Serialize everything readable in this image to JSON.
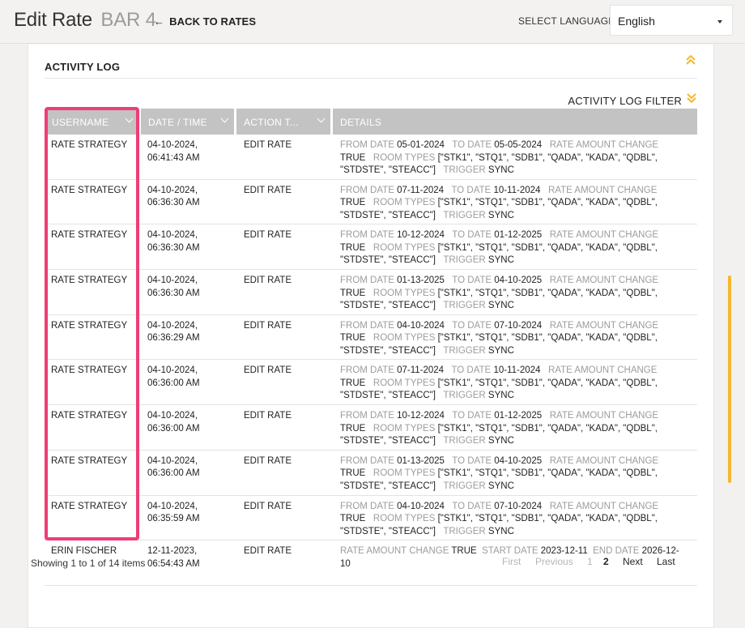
{
  "header": {
    "title": "Edit Rate",
    "subtitle": "BAR 4",
    "back_label": "BACK TO RATES",
    "language_label": "SELECT LANGUAGE",
    "language_value": "English"
  },
  "activity": {
    "title": "ACTIVITY LOG",
    "filter_label": "ACTIVITY LOG FILTER",
    "accent_color": "#f5b730"
  },
  "table": {
    "columns": [
      "USERNAME",
      "DATE / TIME",
      "ACTION T...",
      "DETAILS"
    ],
    "rows": [
      {
        "user": "RATE STRATEGY",
        "date": "04-10-2024,",
        "time": "06:41:43 AM",
        "action": "EDIT RATE",
        "from": "05-01-2024",
        "to": "05-05-2024",
        "rac": "TRUE",
        "rooms": "[\"STK1\", \"STQ1\", \"SDB1\", \"QADA\", \"KADA\", \"QDBL\",",
        "rooms2": "\"STDSTE\", \"STEACC\"]",
        "trigger": "SYNC"
      },
      {
        "user": "RATE STRATEGY",
        "date": "04-10-2024,",
        "time": "06:36:30 AM",
        "action": "EDIT RATE",
        "from": "07-11-2024",
        "to": "10-11-2024",
        "rac": "TRUE",
        "rooms": "[\"STK1\", \"STQ1\", \"SDB1\", \"QADA\", \"KADA\", \"QDBL\",",
        "rooms2": "\"STDSTE\", \"STEACC\"]",
        "trigger": "SYNC"
      },
      {
        "user": "RATE STRATEGY",
        "date": "04-10-2024,",
        "time": "06:36:30 AM",
        "action": "EDIT RATE",
        "from": "10-12-2024",
        "to": "01-12-2025",
        "rac": "TRUE",
        "rooms": "[\"STK1\", \"STQ1\", \"SDB1\", \"QADA\", \"KADA\", \"QDBL\",",
        "rooms2": "\"STDSTE\", \"STEACC\"]",
        "trigger": "SYNC"
      },
      {
        "user": "RATE STRATEGY",
        "date": "04-10-2024,",
        "time": "06:36:30 AM",
        "action": "EDIT RATE",
        "from": "01-13-2025",
        "to": "04-10-2025",
        "rac": "TRUE",
        "rooms": "[\"STK1\", \"STQ1\", \"SDB1\", \"QADA\", \"KADA\", \"QDBL\",",
        "rooms2": "\"STDSTE\", \"STEACC\"]",
        "trigger": "SYNC"
      },
      {
        "user": "RATE STRATEGY",
        "date": "04-10-2024,",
        "time": "06:36:29 AM",
        "action": "EDIT RATE",
        "from": "04-10-2024",
        "to": "07-10-2024",
        "rac": "TRUE",
        "rooms": "[\"STK1\", \"STQ1\", \"SDB1\", \"QADA\", \"KADA\", \"QDBL\",",
        "rooms2": "\"STDSTE\", \"STEACC\"]",
        "trigger": "SYNC"
      },
      {
        "user": "RATE STRATEGY",
        "date": "04-10-2024,",
        "time": "06:36:00 AM",
        "action": "EDIT RATE",
        "from": "07-11-2024",
        "to": "10-11-2024",
        "rac": "TRUE",
        "rooms": "[\"STK1\", \"STQ1\", \"SDB1\", \"QADA\", \"KADA\", \"QDBL\",",
        "rooms2": "\"STDSTE\", \"STEACC\"]",
        "trigger": "SYNC"
      },
      {
        "user": "RATE STRATEGY",
        "date": "04-10-2024,",
        "time": "06:36:00 AM",
        "action": "EDIT RATE",
        "from": "10-12-2024",
        "to": "01-12-2025",
        "rac": "TRUE",
        "rooms": "[\"STK1\", \"STQ1\", \"SDB1\", \"QADA\", \"KADA\", \"QDBL\",",
        "rooms2": "\"STDSTE\", \"STEACC\"]",
        "trigger": "SYNC"
      },
      {
        "user": "RATE STRATEGY",
        "date": "04-10-2024,",
        "time": "06:36:00 AM",
        "action": "EDIT RATE",
        "from": "01-13-2025",
        "to": "04-10-2025",
        "rac": "TRUE",
        "rooms": "[\"STK1\", \"STQ1\", \"SDB1\", \"QADA\", \"KADA\", \"QDBL\",",
        "rooms2": "\"STDSTE\", \"STEACC\"]",
        "trigger": "SYNC"
      },
      {
        "user": "RATE STRATEGY",
        "date": "04-10-2024,",
        "time": "06:35:59 AM",
        "action": "EDIT RATE",
        "from": "04-10-2024",
        "to": "07-10-2024",
        "rac": "TRUE",
        "rooms": "[\"STK1\", \"STQ1\", \"SDB1\", \"QADA\", \"KADA\", \"QDBL\",",
        "rooms2": "\"STDSTE\", \"STEACC\"]",
        "trigger": "SYNC"
      }
    ],
    "last_row": {
      "user": "ERIN FISCHER",
      "date": "12-11-2023,",
      "time": "06:54:43 AM",
      "action": "EDIT RATE",
      "rac": "TRUE",
      "start": "2023-12-11",
      "end": "2026-12-",
      "end2": "10"
    },
    "detail_keys": {
      "from": "FROM DATE",
      "to": "TO DATE",
      "rac": "RATE AMOUNT CHANGE",
      "rooms": "ROOM TYPES",
      "trigger": "TRIGGER",
      "start": "START DATE",
      "end": "END DATE"
    }
  },
  "pagination": {
    "showing": "Showing 1 to 1 of 14 items",
    "first": "First",
    "previous": "Previous",
    "page1": "1",
    "page2": "2",
    "next": "Next",
    "last": "Last"
  },
  "colors": {
    "highlight": "#ee3e75",
    "header_cell": "#c3c3c3",
    "accent": "#f5b730"
  }
}
